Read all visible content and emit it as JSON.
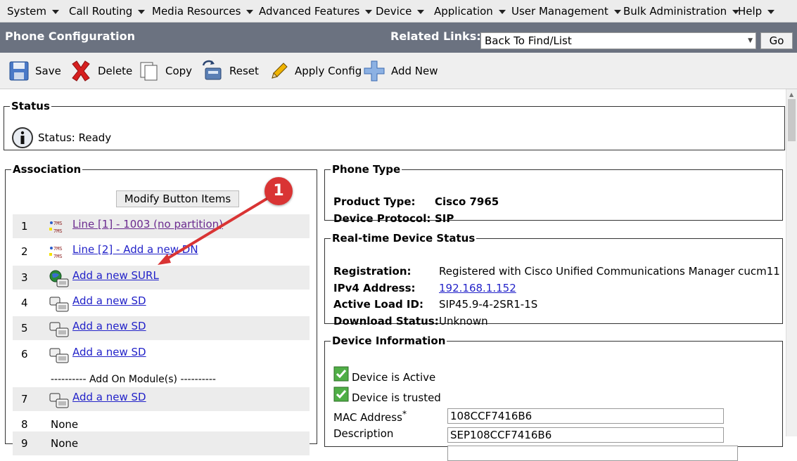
{
  "menu": [
    "System",
    "Call Routing",
    "Media Resources",
    "Advanced Features",
    "Device",
    "Application",
    "User Management",
    "Bulk Administration",
    "Help"
  ],
  "header": {
    "title": "Phone Configuration",
    "related_label": "Related Links:",
    "related_value": "Back To Find/List",
    "go_label": "Go"
  },
  "toolbar": {
    "save": "Save",
    "delete": "Delete",
    "copy": "Copy",
    "reset": "Reset",
    "apply": "Apply Config",
    "add_new": "Add New"
  },
  "status": {
    "legend": "Status",
    "text": "Status: Ready"
  },
  "association": {
    "legend": "Association",
    "modify_button": "Modify Button Items",
    "rows": [
      {
        "num": "1",
        "label": "Line [1] - 1003 (no partition)",
        "icon": "line-icon"
      },
      {
        "num": "2",
        "label": "Line [2] - Add a new DN",
        "icon": "line-icon"
      },
      {
        "num": "3",
        "label": "Add a new SURL",
        "icon": "globe-phone-icon"
      },
      {
        "num": "4",
        "label": "Add a new SD",
        "icon": "speed-dial-icon"
      },
      {
        "num": "5",
        "label": "Add a new SD",
        "icon": "speed-dial-icon"
      },
      {
        "num": "6",
        "label": "Add a new SD",
        "icon": "speed-dial-icon"
      },
      {
        "num": "7",
        "label": "Add a new SD",
        "icon": "speed-dial-icon"
      },
      {
        "num": "8",
        "label": "None"
      },
      {
        "num": "9",
        "label": "None"
      }
    ],
    "addon_label": "---------- Add On Module(s) ----------"
  },
  "phone_type": {
    "legend": "Phone Type",
    "product_label": "Product Type:",
    "product_value": "Cisco 7965",
    "protocol_label": "Device Protocol:",
    "protocol_value": "SIP"
  },
  "realtime": {
    "legend": "Real-time Device Status",
    "registration_label": "Registration:",
    "registration_value": "Registered with Cisco Unified Communications Manager cucm11",
    "ipv4_label": "IPv4 Address:",
    "ipv4_value": "192.168.1.152",
    "load_label": "Active Load ID:",
    "load_value": "SIP45.9-4-2SR1-1S",
    "download_label": "Download Status:",
    "download_value": "Unknown"
  },
  "device_info": {
    "legend": "Device Information",
    "active_label": "Device is Active",
    "trusted_label": "Device is trusted",
    "mac_label": "MAC Address",
    "mac_value": "108CCF7416B6",
    "desc_label": "Description",
    "desc_value": "SEP108CCF7416B6",
    "required_mark": "*"
  },
  "annotation": {
    "number": "1",
    "color": "#d93434"
  }
}
